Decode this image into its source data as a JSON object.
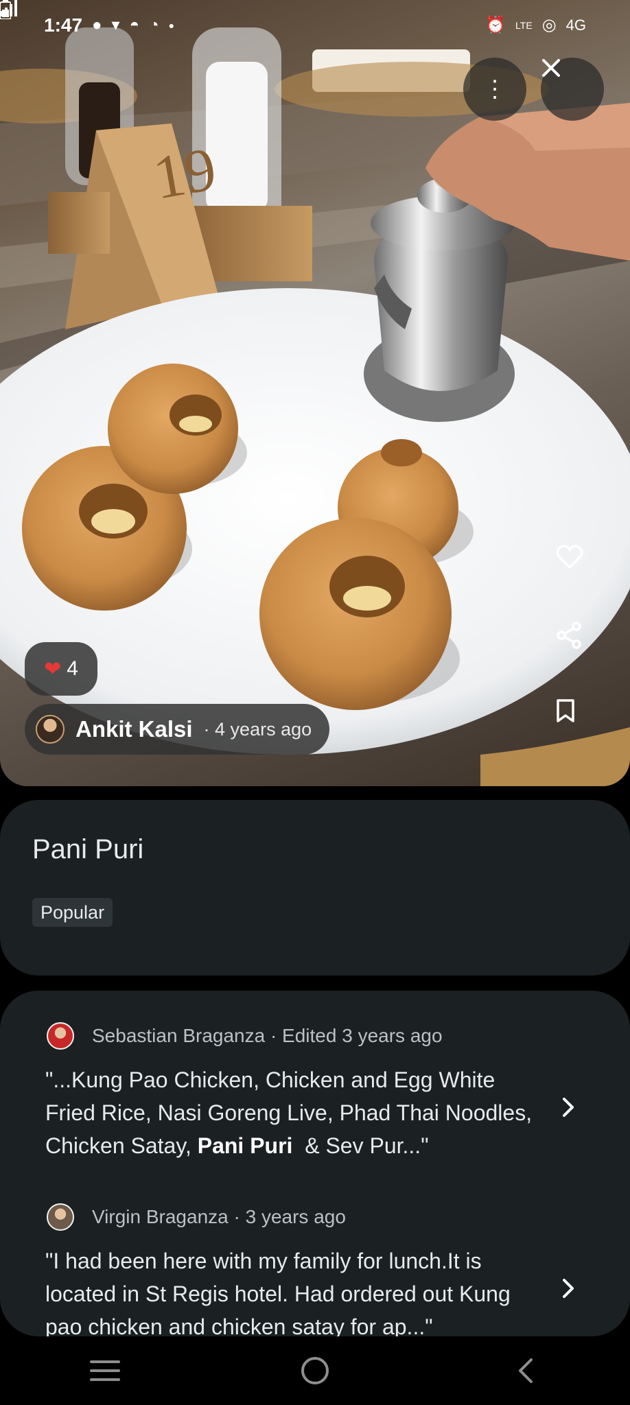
{
  "status_bar": {
    "time": "1:47",
    "network": "4G",
    "left_icons": [
      "chat-bubble-icon",
      "message-icon",
      "snapchat-icon",
      "clock-app-icon",
      "dot-icon"
    ],
    "right_icons": [
      "alarm-icon",
      "volte-icon",
      "hotspot-icon",
      "signal-icon",
      "battery-icon"
    ]
  },
  "photo": {
    "likes": "4",
    "author_name": "Ankit Kalsi",
    "author_time": "· 4 years ago"
  },
  "dish": {
    "title": "Pani Puri",
    "tag": "Popular"
  },
  "reviews": [
    {
      "author": "Sebastian Braganza · Edited 3 years ago",
      "text_before": "\"...Kung Pao Chicken, Chicken and Egg White Fried Rice, Nasi Goreng Live, Phad Thai Noodles, Chicken Satay, ",
      "highlight": "Pani Puri",
      "text_after": "  & Sev Pur...\""
    },
    {
      "author": "Virgin Braganza · 3 years ago",
      "text_before": "\"I had been here with my family for lunch.It is located in St Regis hotel. Had ordered out Kung pao chicken and chicken satay for ap...\"",
      "highlight": "",
      "text_after": ""
    }
  ],
  "colors": {
    "card_bg": "#1b2022",
    "heart": "#e53935",
    "text_secondary": "#bdc1c6"
  }
}
